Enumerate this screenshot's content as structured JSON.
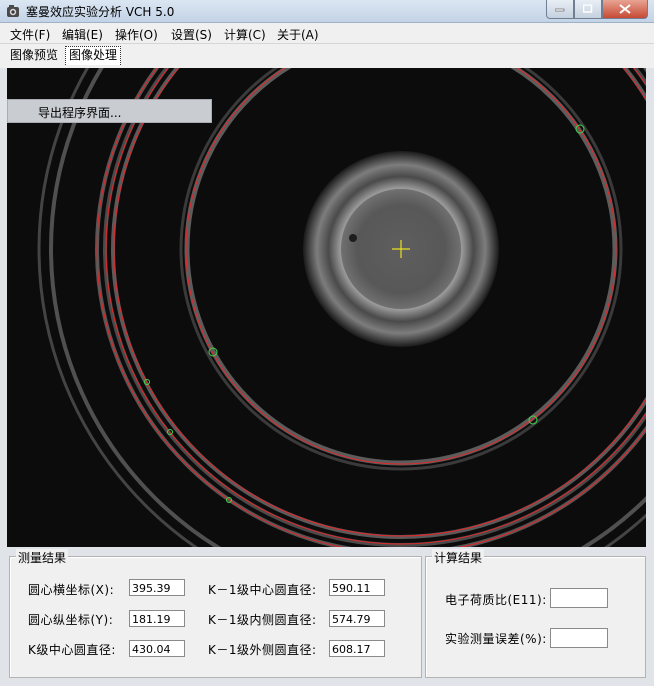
{
  "window": {
    "title": "塞曼效应实验分析 VCH 5.0",
    "controls": {
      "minimize": "minimize-icon",
      "maximize": "maximize-icon",
      "close": "close-icon"
    }
  },
  "menu": [
    "文件(F)",
    "编辑(E)",
    "操作(O)",
    "设置(S)",
    "计算(C)",
    "关于(A)"
  ],
  "tabs": [
    {
      "label": "图像预览",
      "active": false
    },
    {
      "label": "图像处理",
      "active": true
    }
  ],
  "context_menu": {
    "item": "导出程序界面..."
  },
  "measure": {
    "title": "测量结果",
    "center_x_label": "圆心横坐标(X):",
    "center_x_value": "395.39",
    "center_y_label": "圆心纵坐标(Y):",
    "center_y_value": "181.19",
    "k_center_label": "K级中心圆直径:",
    "k_center_value": "430.04",
    "k1_center_label": "K－1级中心圆直径:",
    "k1_center_value": "590.11",
    "k1_inner_label": "K－1级内侧圆直径:",
    "k1_inner_value": "574.79",
    "k1_outer_label": "K－1级外侧圆直径:",
    "k1_outer_value": "608.17"
  },
  "calc": {
    "title": "计算结果",
    "em_label": "电子荷质比(E11):",
    "em_value": "",
    "error_label": "实验测量误差(%):",
    "error_value": ""
  },
  "colors": {
    "fit_circle": "#e0282b",
    "sample_point": "#3bd84a",
    "center_cross": "#e8e020"
  }
}
